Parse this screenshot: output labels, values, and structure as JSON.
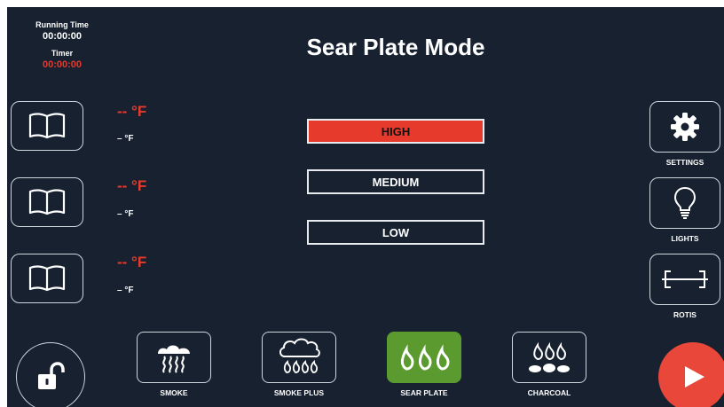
{
  "timers": {
    "running_label": "Running Time",
    "running_value": "00:00:00",
    "timer_label": "Timer",
    "timer_value": "00:00:00"
  },
  "title": "Sear Plate Mode",
  "probes": [
    {
      "temp": "-- °F",
      "set": "– °F"
    },
    {
      "temp": "-- °F",
      "set": "– °F"
    },
    {
      "temp": "-- °F",
      "set": "– °F"
    }
  ],
  "modes": [
    {
      "label": "HIGH",
      "active": true
    },
    {
      "label": "MEDIUM",
      "active": false
    },
    {
      "label": "LOW",
      "active": false
    }
  ],
  "side_buttons": {
    "settings": "SETTINGS",
    "lights": "LIGHTS",
    "rotis": "ROTIS"
  },
  "fuel_modes": {
    "smoke": "SMOKE",
    "smoke_plus": "SMOKE PLUS",
    "sear_plate": "SEAR PLATE",
    "charcoal": "CHARCOAL",
    "active": "sear_plate"
  },
  "icons": {
    "probe": "book-icon",
    "settings": "gear-icon",
    "lights": "lightbulb-icon",
    "rotis": "rotisserie-icon",
    "lock": "unlock-icon",
    "play": "play-icon"
  },
  "colors": {
    "background": "#172130",
    "accent_red": "#e53a2c",
    "active_green": "#5a9a2f",
    "play": "#e8473a"
  }
}
